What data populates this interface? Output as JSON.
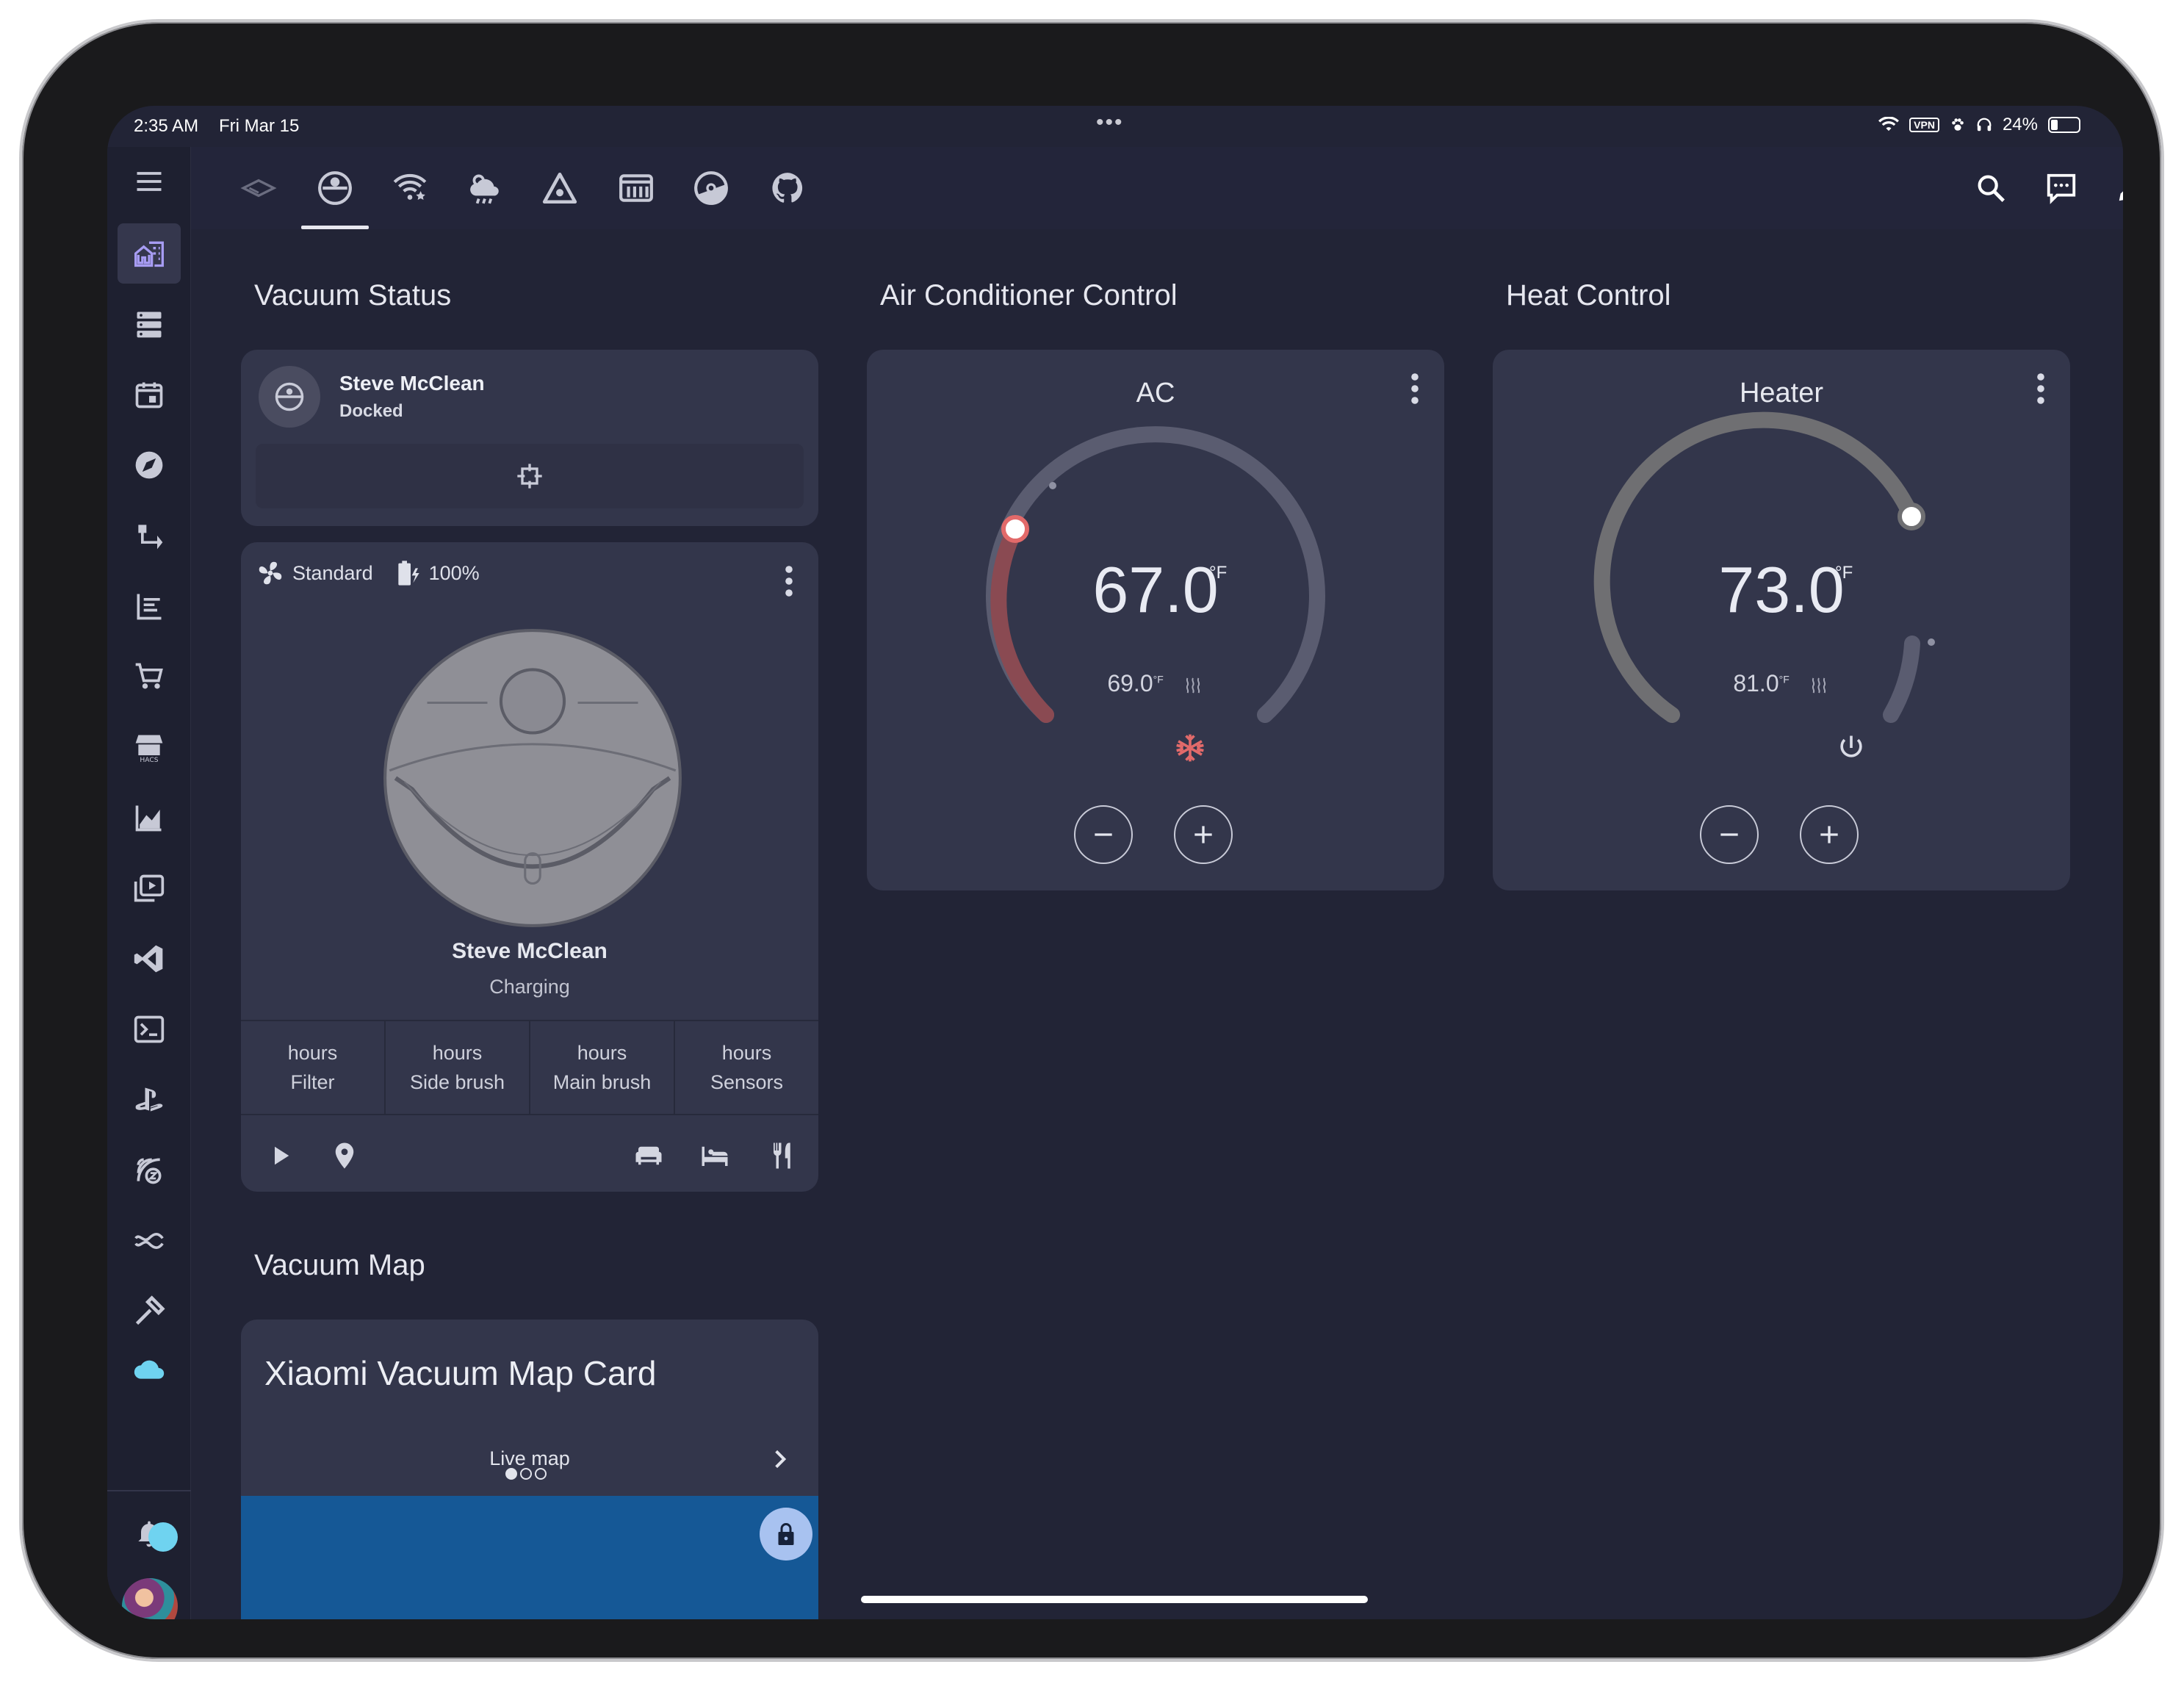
{
  "status_bar": {
    "time": "2:35 AM",
    "date": "Fri Mar 15",
    "vpn": "VPN",
    "battery": "24%"
  },
  "tabs": [
    "rooms-icon",
    "robot-vacuum-icon",
    "wifi-star-icon",
    "weather-icon",
    "home-assistant-delta-icon",
    "nas-icon",
    "pokeball-icon",
    "github-icon"
  ],
  "sections": {
    "vacuum_status": "Vacuum Status",
    "ac_control": "Air Conditioner Control",
    "heat_control": "Heat Control",
    "vacuum_map": "Vacuum Map"
  },
  "entity_card": {
    "name": "Steve McClean",
    "state": "Docked"
  },
  "vacuum_card": {
    "fan_speed": "Standard",
    "battery": "100%",
    "name": "Steve McClean",
    "status": "Charging",
    "stats": [
      {
        "value": "hours",
        "label": "Filter"
      },
      {
        "value": "hours",
        "label": "Side brush"
      },
      {
        "value": "hours",
        "label": "Main brush"
      },
      {
        "value": "hours",
        "label": "Sensors"
      }
    ]
  },
  "ac_card": {
    "title": "AC",
    "target": "67.0",
    "unit": "°F",
    "current": "69.0",
    "current_unit": "°F",
    "mode_icon": "snowflake-icon",
    "accent": "#e26a6a"
  },
  "heater_card": {
    "title": "Heater",
    "target": "73.0",
    "unit": "°F",
    "current": "81.0",
    "current_unit": "°F",
    "mode_icon": "power-icon"
  },
  "map_card": {
    "title": "Xiaomi Vacuum Map Card",
    "mode": "Live map",
    "map_color": "#155896"
  }
}
